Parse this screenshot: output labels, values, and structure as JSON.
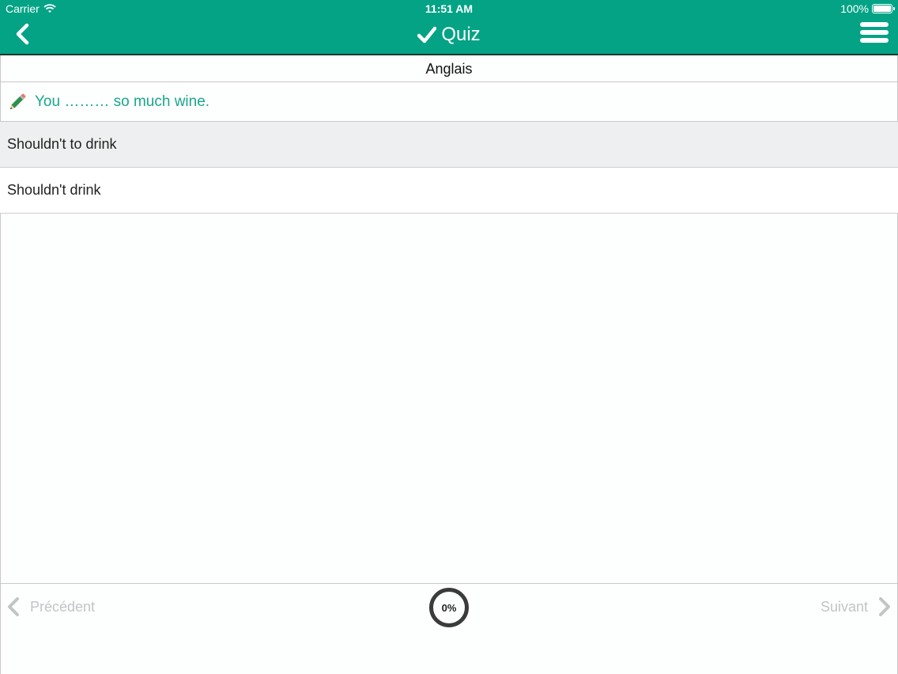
{
  "status_bar": {
    "carrier": "Carrier",
    "time": "11:51 AM",
    "battery": "100%",
    "battery_level": 1.0
  },
  "nav": {
    "title": "Quiz",
    "back_icon": "chevron-left-icon",
    "title_icon": "checkmark-icon",
    "menu_icon": "hamburger-menu-icon"
  },
  "subject": "Anglais",
  "question": {
    "icon": "pencil-icon",
    "text": "You ……… so much wine."
  },
  "answers": [
    {
      "label": "Shouldn't to drink",
      "selected": true
    },
    {
      "label": "Shouldn't drink",
      "selected": false
    }
  ],
  "footer": {
    "prev_label": "Précédent",
    "next_label": "Suivant",
    "progress_text": "0%",
    "progress_value": 0
  },
  "colors": {
    "primary": "#04a386",
    "question_text": "#1aa78b",
    "disabled": "#c2c4c6"
  }
}
